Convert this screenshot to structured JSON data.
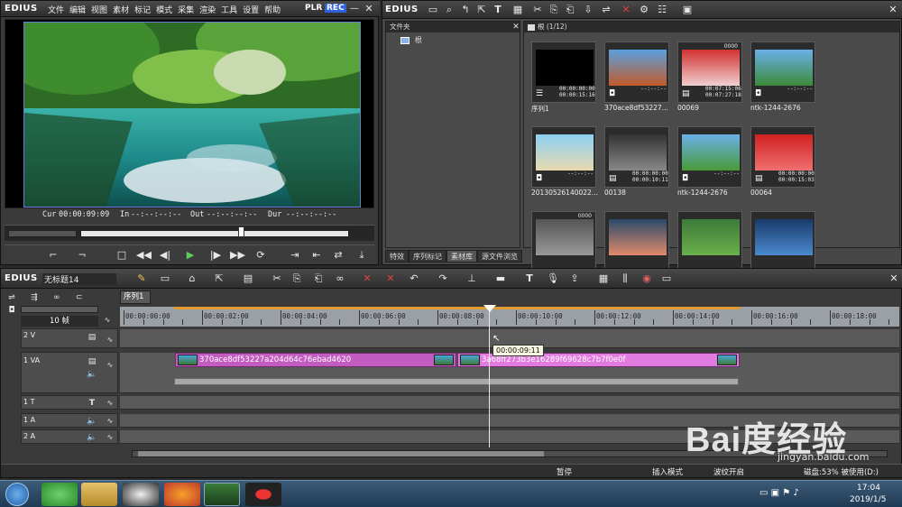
{
  "preview": {
    "logo": "EDIUS",
    "menu": [
      "文件",
      "编辑",
      "视图",
      "素材",
      "标记",
      "模式",
      "采集",
      "渲染",
      "工具",
      "设置",
      "帮助"
    ],
    "plr": "PLR",
    "rec": "REC",
    "cur_label": "Cur",
    "cur_value": "00:00:09:09",
    "in_label": "In",
    "in_value": "--:--:--:--",
    "out_label": "Out",
    "out_value": "--:--:--:--",
    "dur_label": "Dur",
    "dur_value": "--:--:--:--"
  },
  "bin": {
    "logo": "EDIUS",
    "folder_header": "文件夹",
    "root_label": "根",
    "clip_header": "根 (1/12)",
    "clips": [
      {
        "name": "序列1",
        "num": "",
        "meta1": "00:00:00:00",
        "meta2": "00:00:15:16",
        "icon": "sequence-icon"
      },
      {
        "name": "370ace8df53227...",
        "num": "",
        "meta1": "--:--:--",
        "meta2": "",
        "icon": "camera-icon"
      },
      {
        "name": "00069",
        "num": "0000",
        "meta1": "00:07:15:06",
        "meta2": "00:07:27:18",
        "icon": "film-icon"
      },
      {
        "name": "ntk-1244-2676",
        "num": "",
        "meta1": "--:--:--",
        "meta2": "",
        "icon": "camera-icon"
      },
      {
        "name": "20130526140022...",
        "num": "",
        "meta1": "--:--:--",
        "meta2": "",
        "icon": "camera-icon"
      },
      {
        "name": "00138",
        "num": "",
        "meta1": "00:00:00:00",
        "meta2": "00:00:10:11",
        "icon": "film-icon"
      },
      {
        "name": "ntk-1244-2676",
        "num": "",
        "meta1": "--:--:--",
        "meta2": "",
        "icon": "camera-icon"
      },
      {
        "name": "00064",
        "num": "",
        "meta1": "00:00:00:00",
        "meta2": "00:00:15:03",
        "icon": "film-icon"
      },
      {
        "name": "",
        "num": "0000",
        "meta1": "",
        "meta2": "",
        "icon": ""
      },
      {
        "name": "",
        "num": "",
        "meta1": "",
        "meta2": "",
        "icon": ""
      },
      {
        "name": "",
        "num": "",
        "meta1": "",
        "meta2": "",
        "icon": ""
      },
      {
        "name": "",
        "num": "",
        "meta1": "",
        "meta2": "",
        "icon": ""
      }
    ],
    "tabs": [
      "特效",
      "序列标记",
      "素材库",
      "源文件浏览"
    ]
  },
  "timeline": {
    "logo": "EDIUS",
    "project": "无标题14",
    "seq_tab": "序列1",
    "zoom": "10 帧",
    "ruler": [
      "00:00:00:00",
      "00:00:02:00",
      "00:00:04:00",
      "00:00:06:00",
      "00:00:08:00",
      "00:00:10:00",
      "00:00:12:00",
      "00:00:14:00",
      "00:00:16:00",
      "00:00:18:00"
    ],
    "tracks": [
      {
        "name": "2 V"
      },
      {
        "name": "1 VA"
      },
      {
        "name": "1 T"
      },
      {
        "name": "1 A"
      },
      {
        "name": "2 A"
      }
    ],
    "clip1": "370ace8df53227a204d64c76ebad4620",
    "clip2": "3a68ff273b3e16289f69628c7b7f0e0f",
    "tooltip": "00:00:09:11",
    "status": {
      "pause": "暂停",
      "insert_mode": "插入模式",
      "ripple": "波纹开启",
      "disk": "磁盘:53% 被使用(D:)"
    }
  },
  "taskbar": {
    "time": "17:04",
    "date": "2019/1/5"
  },
  "watermark": {
    "brand": "Bai度经验",
    "url": "jingyan.baidu.com"
  }
}
